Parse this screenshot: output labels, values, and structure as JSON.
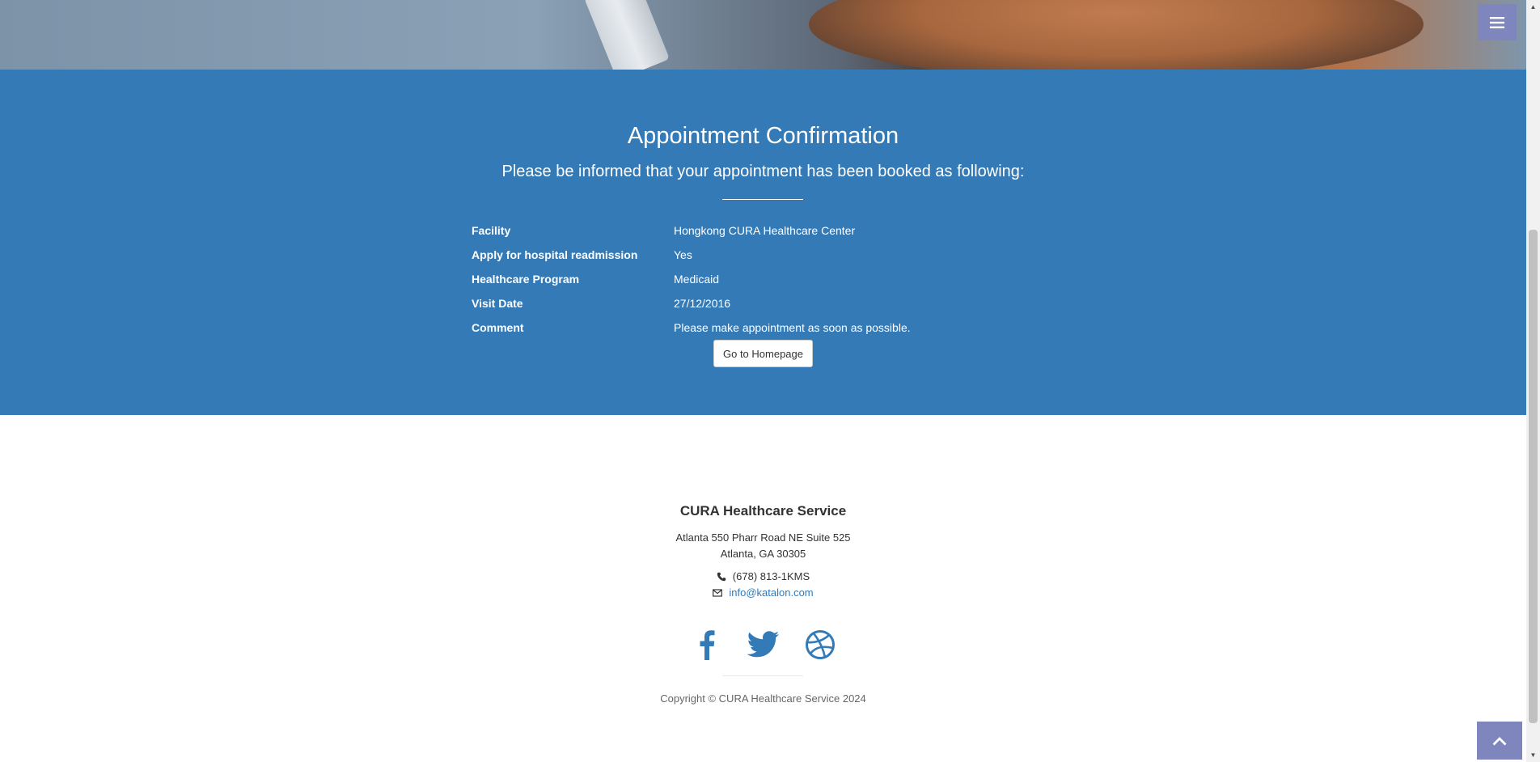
{
  "confirmation": {
    "title": "Appointment Confirmation",
    "lead": "Please be informed that your appointment has been booked as following:",
    "rows": [
      {
        "label": "Facility",
        "value": "Hongkong CURA Healthcare Center"
      },
      {
        "label": "Apply for hospital readmission",
        "value": "Yes"
      },
      {
        "label": "Healthcare Program",
        "value": "Medicaid"
      },
      {
        "label": "Visit Date",
        "value": "27/12/2016"
      },
      {
        "label": "Comment",
        "value": "Please make appointment as soon as possible."
      }
    ],
    "home_button": "Go to Homepage"
  },
  "footer": {
    "brand": "CURA Healthcare Service",
    "address_line1": "Atlanta 550 Pharr Road NE Suite 525",
    "address_line2": "Atlanta, GA 30305",
    "phone": "(678) 813-1KMS",
    "email": "info@katalon.com",
    "copyright": "Copyright © CURA Healthcare Service 2024"
  },
  "icons": {
    "menu": "bars-icon",
    "phone": "phone-icon",
    "email": "envelope-icon",
    "social": [
      "facebook-icon",
      "twitter-icon",
      "dribbble-icon"
    ],
    "to_top": "chevron-up-icon"
  },
  "colors": {
    "primary": "#337ab7",
    "accent": "#7f86bd"
  }
}
